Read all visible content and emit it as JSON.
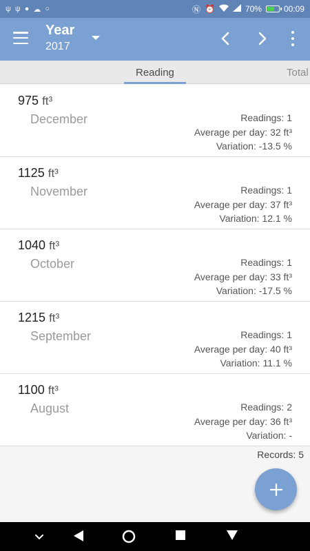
{
  "status_bar": {
    "battery_percent": "70%",
    "time": "00:09",
    "battery_level": 0.7,
    "icons": [
      "usb-icon",
      "usb-icon",
      "drop-icon",
      "cloud-icon",
      "circle-icon",
      "nfc-icon",
      "alarm-icon",
      "wifi-icon",
      "signal-icon",
      "battery-icon"
    ]
  },
  "app_bar": {
    "title": "Year",
    "subtitle": "2017"
  },
  "tabs": [
    {
      "label": "Reading",
      "active": true
    },
    {
      "label": "Total",
      "active": false
    }
  ],
  "records": [
    {
      "amount": "975",
      "unit": "ft³",
      "month": "December",
      "readings": "Readings: 1",
      "average": "Average per day: 32 ft³",
      "variation": "Variation: -13.5 %"
    },
    {
      "amount": "1125",
      "unit": "ft³",
      "month": "November",
      "readings": "Readings: 1",
      "average": "Average per day: 37 ft³",
      "variation": "Variation: 12.1 %"
    },
    {
      "amount": "1040",
      "unit": "ft³",
      "month": "October",
      "readings": "Readings: 1",
      "average": "Average per day: 33 ft³",
      "variation": "Variation: -17.5 %"
    },
    {
      "amount": "1215",
      "unit": "ft³",
      "month": "September",
      "readings": "Readings: 1",
      "average": "Average per day: 40 ft³",
      "variation": "Variation: 11.1 %"
    },
    {
      "amount": "1100",
      "unit": "ft³",
      "month": "August",
      "readings": "Readings: 2",
      "average": "Average per day: 36 ft³",
      "variation": "Variation: -"
    }
  ],
  "footer": {
    "records_count": "Records: 5"
  },
  "colors": {
    "status_bar": "#5f84b5",
    "app_bar": "#7aa1d2",
    "accent": "#7aa1d2",
    "battery_fill": "#4cd24c"
  }
}
